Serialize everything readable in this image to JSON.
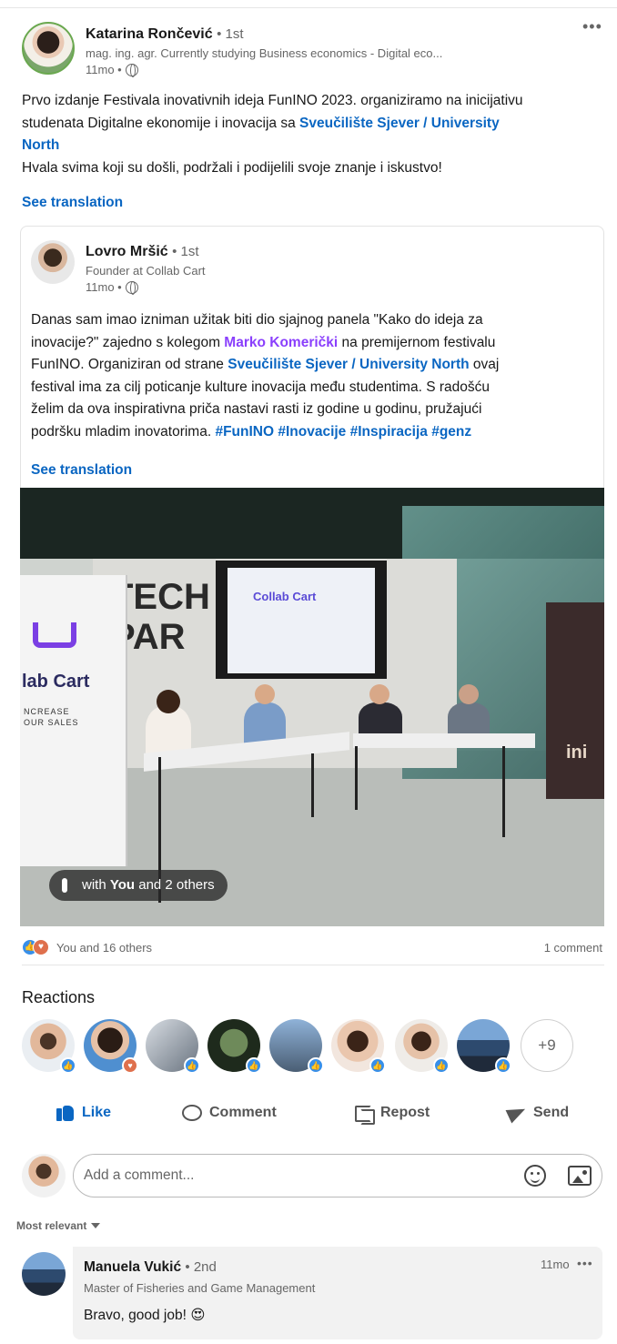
{
  "post": {
    "author": {
      "name": "Katarina Rončević",
      "degree": "• 1st",
      "headline": "mag. ing. agr. Currently studying Business economics - Digital eco...",
      "time": "11mo •"
    },
    "more_label": "•••",
    "text_line1": "Prvo izdanje Festivala inovativnih ideja FunINO 2023. organiziramo na inicijativu",
    "text_line2": "studenata Digitalne ekonomije i inovacija sa ",
    "text_mention": "Sveučilište Sjever / University",
    "text_mention2": "North",
    "text_line3": "Hvala svima koji su došli, podržali i podijelili svoje znanje i iskustvo!",
    "see_translation": "See translation"
  },
  "shared": {
    "author": {
      "name": "Lovro Mršić",
      "degree": "• 1st",
      "headline": "Founder at Collab Cart",
      "time": "11mo •"
    },
    "text": {
      "p1": "Danas sam imao izniman užitak biti dio sjajnog panela \"Kako do ideja za",
      "p2a": "inovacije?\" zajedno s kolegom ",
      "p2_mention": "Marko Komerički",
      "p2b": " na premijernom festivalu",
      "p3a": "FunINO. Organiziran od strane ",
      "p3_mention": "Sveučilište Sjever / University North",
      "p3b": " ovaj",
      "p4": "festival ima za cilj poticanje kulture inovacija među studentima. S radošću",
      "p5": "želim da ova inspirativna priča nastavi rasti iz godine u godinu, pružajući",
      "p6a": "podršku mladim inovatorima. ",
      "p6_tags": "#FunINO #Inovacije #Inspiracija #genz"
    },
    "see_translation": "See translation",
    "photo": {
      "wall_sign": "TECH\nPAR",
      "screen_text": "Collab Cart",
      "banner_brand": "lab Cart",
      "banner_slogan": "NCREASE\nOUR SALES",
      "banner_right": "ini",
      "tag_prefix": "with ",
      "tag_you": "You",
      "tag_suffix": " and 2 others"
    }
  },
  "social": {
    "reactions_summary": "You and 16 others",
    "comments_summary": "1 comment",
    "reactions_title": "Reactions",
    "more_reactors": "+9",
    "colors": {
      "like": "#378fe9",
      "love": "#df704d",
      "link": "#0a66c2"
    }
  },
  "actions": {
    "like": "Like",
    "comment": "Comment",
    "repost": "Repost",
    "send": "Send"
  },
  "comment_input": {
    "placeholder": "Add a comment..."
  },
  "sort_label": "Most relevant",
  "comments": [
    {
      "name": "Manuela Vukić",
      "degree": "• 2nd",
      "headline": "Master of Fisheries and Game Management",
      "time": "11mo",
      "more": "•••",
      "text": "Bravo, good job! 😍"
    }
  ]
}
